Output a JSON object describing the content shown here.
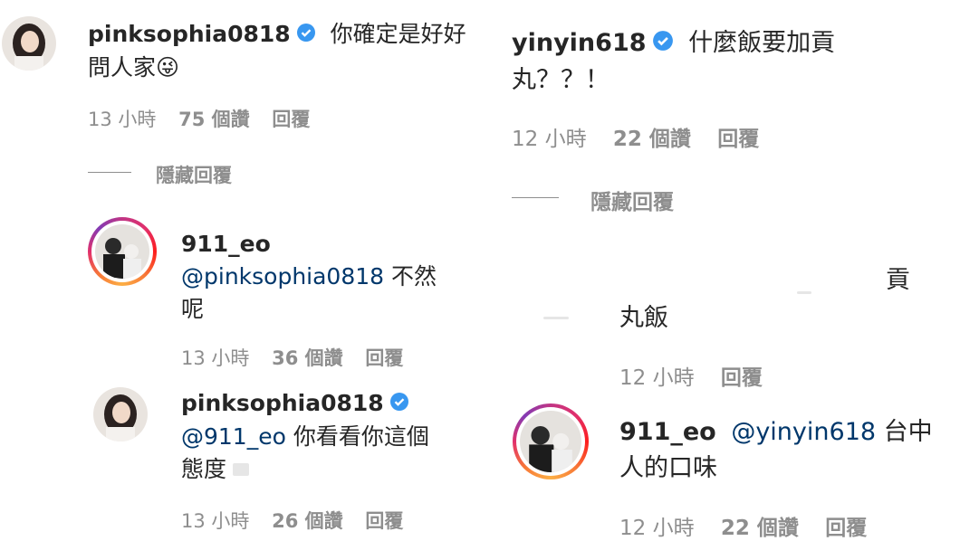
{
  "left": {
    "comment": {
      "username": "pinksophia0818",
      "text": "你確定是好好問人家😜",
      "text_line1": "你確定是好好",
      "text_line2": "問人家",
      "emoji": "😜",
      "time": "13 小時",
      "likes": "75 個讚",
      "reply": "回覆"
    },
    "hide_replies": "隱藏回覆",
    "reply1": {
      "username": "911_eo",
      "mention": "@pinksophia0818",
      "text_line1": " 不然",
      "text_line2": "呢",
      "time": "13 小時",
      "likes": "36 個讚",
      "reply": "回覆"
    },
    "reply2": {
      "username": "pinksophia0818",
      "mention": "@911_eo",
      "text_line1": " 你看看你這個",
      "text_line2": "態度",
      "time": "13 小時",
      "likes": "26 個讚",
      "reply": "回覆"
    }
  },
  "right": {
    "comment": {
      "username": "yinyin618",
      "text_line1": "什麼飯要加貢",
      "text_line2": "丸？？！",
      "time": "12 小時",
      "likes": "22 個讚",
      "reply": "回覆"
    },
    "hide_replies": "隱藏回覆",
    "reply1": {
      "text_line1": "貢",
      "text_line2": "丸飯",
      "time": "12 小時",
      "reply": "回覆"
    },
    "reply2": {
      "username": "911_eo",
      "mention": "@yinyin618",
      "text_line1": " 台中",
      "text_line2": "人的口味",
      "time": "12 小時",
      "likes": "22 個讚",
      "reply": "回覆"
    }
  },
  "colors": {
    "text": "#262626",
    "meta": "#8e8e8e",
    "mention": "#00376b",
    "verified": "#3897f0"
  }
}
